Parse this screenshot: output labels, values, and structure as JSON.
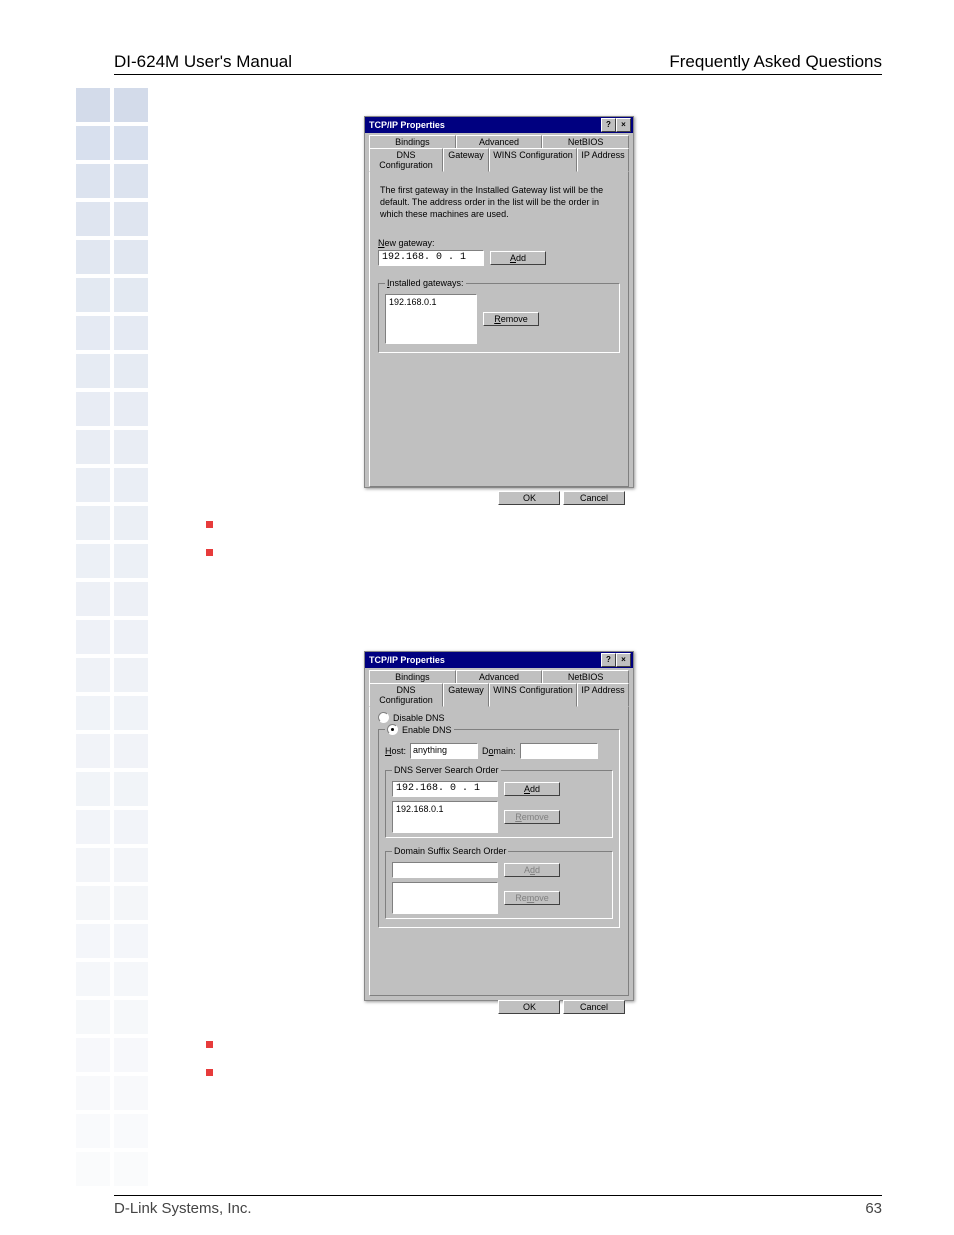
{
  "header": {
    "left": "DI-624M User's Manual",
    "right": "Frequently Asked Questions"
  },
  "footer": {
    "left": "D-Link Systems, Inc.",
    "right": "63"
  },
  "dialog1": {
    "title": "TCP/IP Properties",
    "help_btn": "?",
    "close_btn": "×",
    "tabs_row1": [
      "Bindings",
      "Advanced",
      "NetBIOS"
    ],
    "tabs_row2": [
      "DNS Configuration",
      "Gateway",
      "WINS Configuration",
      "IP Address"
    ],
    "active_tab": "Gateway",
    "description": "The first gateway in the Installed Gateway list will be the default. The address order in the list will be the order in which these machines are used.",
    "new_gateway_label": "New gateway:",
    "new_gateway_value": "192.168.  0 .  1",
    "add_label": "Add",
    "installed_label": "Installed gateways:",
    "installed_item": "192.168.0.1",
    "remove_label": "Remove",
    "ok_label": "OK",
    "cancel_label": "Cancel",
    "underline_N": "N",
    "underline_A": "A",
    "underline_I": "I",
    "underline_R": "R"
  },
  "dialog2": {
    "title": "TCP/IP Properties",
    "help_btn": "?",
    "close_btn": "×",
    "tabs_row1": [
      "Bindings",
      "Advanced",
      "NetBIOS"
    ],
    "tabs_row2": [
      "DNS Configuration",
      "Gateway",
      "WINS Configuration",
      "IP Address"
    ],
    "active_tab": "DNS Configuration",
    "disable_label": "Disable DNS",
    "enable_label": "Enable DNS",
    "host_label": "Host:",
    "host_value": "anything",
    "domain_label": "Domain:",
    "domain_value": "",
    "dns_order_label": "DNS Server Search Order",
    "dns_input": "192.168.  0 .  1",
    "dns_list_item": "192.168.0.1",
    "add_label": "Add",
    "remove_label": "Remove",
    "suffix_label": "Domain Suffix Search Order",
    "suffix_input": "",
    "ok_label": "OK",
    "cancel_label": "Cancel",
    "underline_H": "H",
    "underline_O": "o",
    "underline_A": "A",
    "underline_R": "R"
  }
}
